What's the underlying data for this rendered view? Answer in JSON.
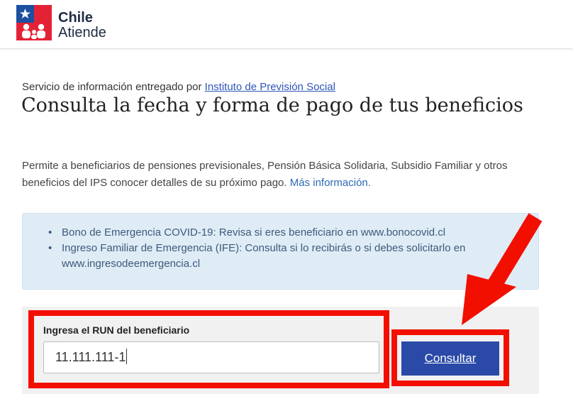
{
  "header": {
    "logo_line1": "Chile",
    "logo_line2": "Atiende"
  },
  "provider": {
    "prefix": "Servicio de información entregado por ",
    "link": "Instituto de Previsión Social"
  },
  "title": "Consulta la fecha y forma de pago de tus beneficios",
  "description": {
    "text": "Permite a beneficiarios de pensiones previsionales, Pensión Básica Solidaria, Subsidio Familiar y otros beneficios del IPS conocer detalles de su próximo pago. ",
    "link": "Más información."
  },
  "alert": {
    "items": [
      "Bono de Emergencia COVID-19: Revisa si eres beneficiario en www.bonocovid.cl",
      "Ingreso Familiar de Emergencia (IFE): Consulta si lo recibirás o si debes solicitarlo en www.ingresodeemergencia.cl"
    ]
  },
  "form": {
    "label": "Ingresa el RUN del beneficiario",
    "value": "11.111.111-1",
    "button": "Consultar"
  },
  "colors": {
    "annotation_red": "#f20f00",
    "button_blue": "#2b4aa8",
    "link_blue": "#2d55b8",
    "alert_bg": "#dfecf6"
  }
}
